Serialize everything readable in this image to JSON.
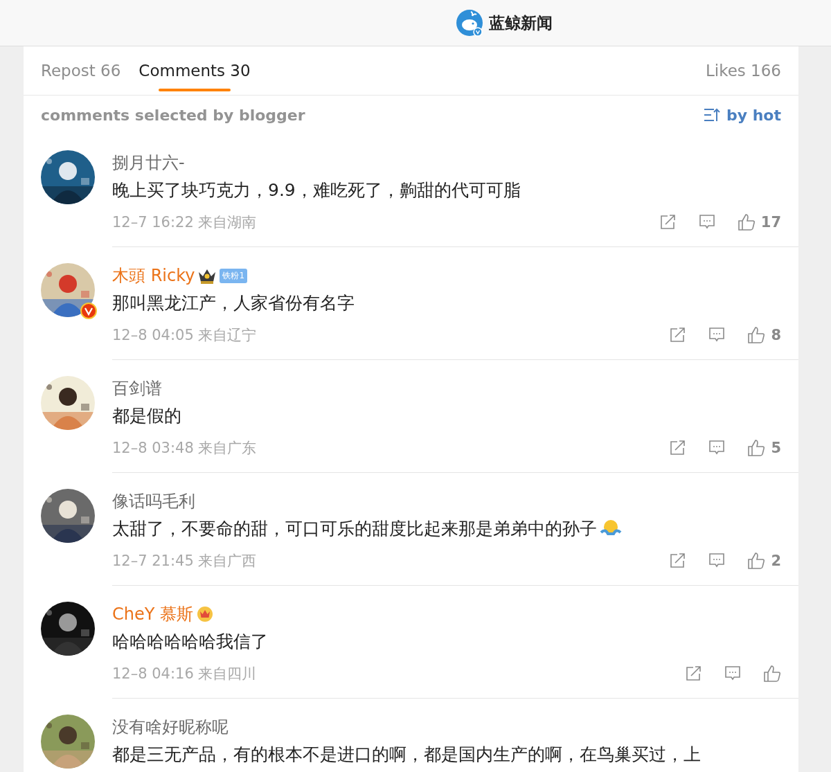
{
  "header": {
    "title": "蓝鲸新闻",
    "verified": true
  },
  "tabs": [
    {
      "label": "Repost",
      "count": "66",
      "selected": false
    },
    {
      "label": "Comments",
      "count": "30",
      "selected": true
    },
    {
      "label": "Likes",
      "count": "166",
      "selected": false
    }
  ],
  "filter": {
    "label": "comments selected by blogger",
    "sort": "by hot"
  },
  "comments": [
    {
      "name": "捌月廿六-",
      "color": "#6b6b6b",
      "text": "晚上买了块巧克力，9.9，难吃死了，齁甜的代可可脂",
      "time": "12–7 16:22",
      "location": "来自湖南",
      "likes": "17"
    },
    {
      "name": "木頭 Ricky",
      "color": "#eb7319",
      "verified": true,
      "badges": [
        {
          "kind": "crown"
        },
        {
          "kind": "fan",
          "label": "铁粉1"
        }
      ],
      "text": "那叫黑龙江产，人家省份有名字",
      "time": "12–8 04:05",
      "location": "来自辽宁",
      "likes": "8"
    },
    {
      "name": "百剑谱",
      "color": "#6b6b6b",
      "text": "都是假的",
      "time": "12–8 03:48",
      "location": "来自广东",
      "likes": "5"
    },
    {
      "name": "像话吗毛利",
      "color": "#6b6b6b",
      "text": "太甜了，不要命的甜，可口可乐的甜度比起来那是弟弟中的孙子",
      "trailing_emoji": true,
      "time": "12–7 21:45",
      "location": "来自广西",
      "likes": "2"
    },
    {
      "name": "CheY 慕斯",
      "color": "#eb7319",
      "badges": [
        {
          "kind": "gold-crown"
        }
      ],
      "text": "哈哈哈哈哈哈我信了",
      "time": "12–8 04:16",
      "location": "来自四川"
    },
    {
      "name": "没有啥好昵称呢",
      "color": "#6b6b6b",
      "text": "都是三无产品，有的根本不是进口的啊，都是国内生产的啊，在鸟巢买过，上"
    }
  ]
}
